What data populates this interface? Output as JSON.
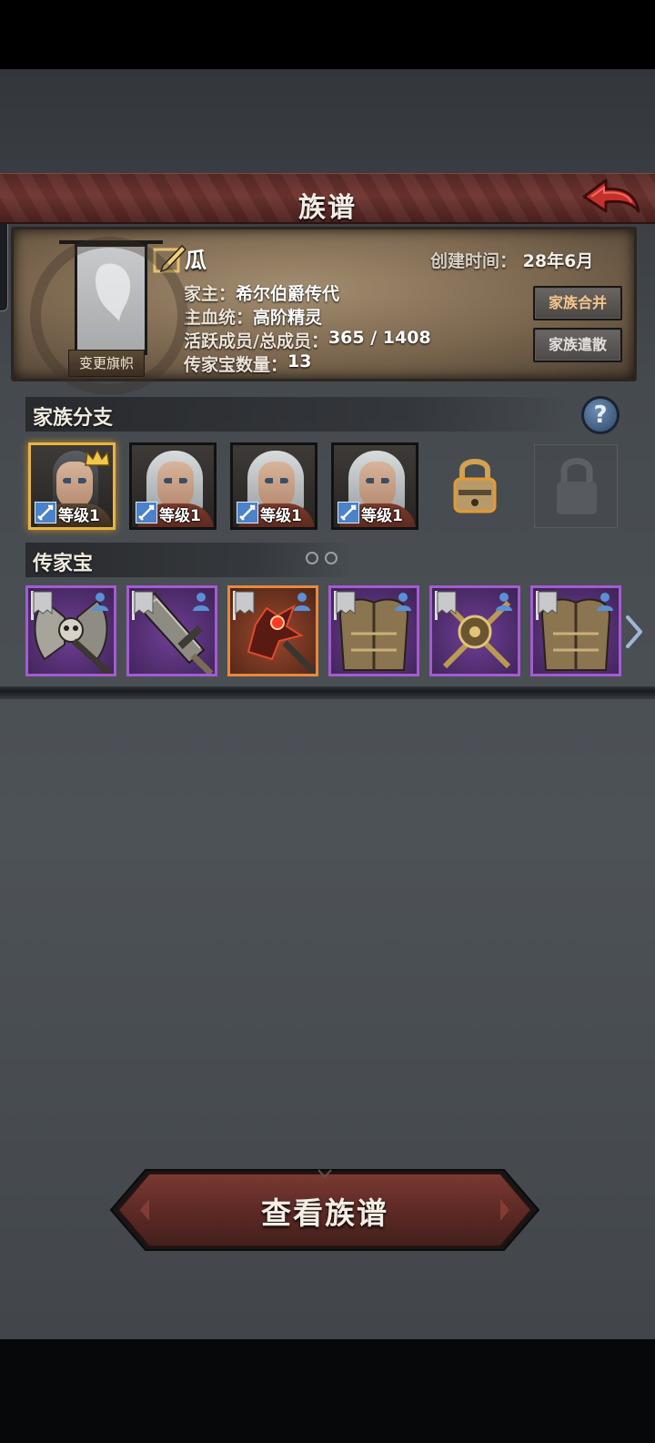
{
  "header": {
    "title": "族谱"
  },
  "clan": {
    "banner_button": "变更旗帜",
    "name": "瓜",
    "created_label": "创建时间：",
    "created_value": "28年6月",
    "leader_label": "家主：",
    "leader_value": "希尔伯爵传代",
    "bloodline_label": "主血统：",
    "bloodline_value": "高阶精灵",
    "members_label": "活跃成员/总成员：",
    "members_value": "365 / 1408",
    "heirloom_count_label": "传家宝数量：",
    "heirloom_count_value": "13",
    "merge_button": "家族合并",
    "disband_button": "家族遣散"
  },
  "branches": {
    "title": "家族分支",
    "help": "?",
    "slots": [
      {
        "level": "等级1",
        "selected": true,
        "leader": true
      },
      {
        "level": "等级1",
        "selected": false
      },
      {
        "level": "等级1",
        "selected": false
      },
      {
        "level": "等级1",
        "selected": false
      }
    ],
    "locked_slots": 2
  },
  "heirlooms": {
    "title": "传家宝",
    "items": [
      {
        "icon": "skull-axe-icon",
        "rarity": "purple"
      },
      {
        "icon": "greatsword-icon",
        "rarity": "purple"
      },
      {
        "icon": "flaming-mace-icon",
        "rarity": "orange"
      },
      {
        "icon": "breastplate-icon",
        "rarity": "purple"
      },
      {
        "icon": "crossed-swords-shield-icon",
        "rarity": "purple"
      },
      {
        "icon": "breastplate-icon",
        "rarity": "purple"
      }
    ]
  },
  "colors": {
    "title_bar": "#6f3530",
    "purple_rarity": "#a45bd1",
    "orange_rarity": "#e68a3c",
    "selected_border": "#e9b441",
    "merge_text": "#f6c78a"
  },
  "footer": {
    "view_button": "查看族谱"
  }
}
